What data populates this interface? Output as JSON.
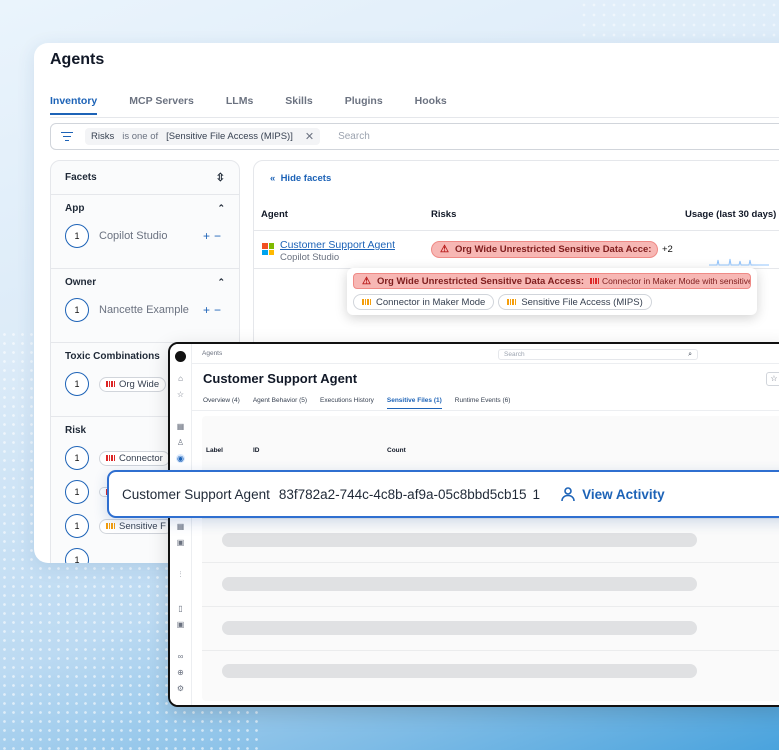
{
  "page": {
    "title": "Agents"
  },
  "tabs": [
    "Inventory",
    "MCP Servers",
    "LLMs",
    "Skills",
    "Plugins",
    "Hooks"
  ],
  "filter": {
    "field": "Risks",
    "operator": "is one of",
    "value": "[Sensitive File Access (MIPS)]",
    "search_placeholder": "Search"
  },
  "facets": {
    "title": "Facets",
    "sections": [
      {
        "title": "App",
        "items": [
          {
            "count": "1",
            "label": "Copilot Studio"
          }
        ]
      },
      {
        "title": "Owner",
        "items": [
          {
            "count": "1",
            "label": "Nancette Example"
          }
        ]
      },
      {
        "title": "Toxic Combinations",
        "items": [
          {
            "count": "1",
            "label": "Org Wide"
          }
        ]
      },
      {
        "title": "Risk",
        "items": [
          {
            "count": "1",
            "label": "Connector"
          },
          {
            "count": "1",
            "label": ""
          },
          {
            "count": "1",
            "label": "Sensitive F"
          },
          {
            "count": "1",
            "label": ""
          }
        ]
      }
    ],
    "plus": "+",
    "minus": "−"
  },
  "table": {
    "hide_facets": "Hide facets",
    "columns": {
      "agent": "Agent",
      "risks": "Risks",
      "usage": "Usage (last 30 days)"
    },
    "row": {
      "agent": "Customer Support Agent",
      "app": "Copilot Studio",
      "risk": "Org Wide Unrestricted Sensitive Data Acce:",
      "more": "+2"
    }
  },
  "tooltip": {
    "main": "Org Wide Unrestricted Sensitive Data Access:",
    "main_sub": "Connector in Maker Mode with sensitive",
    "chips": [
      "Connector in Maker Mode",
      "Sensitive File Access (MIPS)"
    ]
  },
  "detail": {
    "breadcrumb": "Agents",
    "search_placeholder": "Search",
    "title": "Customer Support Agent",
    "tabs": [
      "Overview (4)",
      "Agent Behavior (5)",
      "Executions History",
      "Sensitive Files (1)",
      "Runtime Events (6)"
    ],
    "columns": {
      "label": "Label",
      "id": "ID",
      "count": "Count"
    }
  },
  "highlight": {
    "name": "Customer Support Agent",
    "id": "83f782a2-744c-4c8b-af9a-05c8bbd5cb15",
    "count": "1",
    "action": "View Activity"
  },
  "colors": {
    "accent": "#1d63b7",
    "risk_bg": "#f7b7b4",
    "risk_red": "#dc2626",
    "risk_orange": "#f59e0b"
  }
}
